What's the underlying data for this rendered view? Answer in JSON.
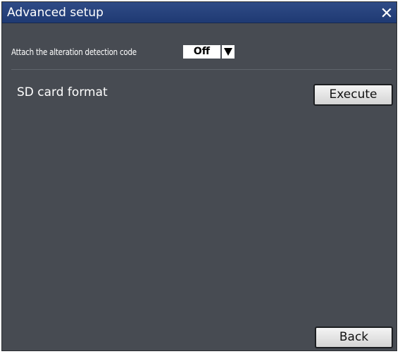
{
  "dialog": {
    "title": "Advanced setup",
    "close_icon": "close-icon"
  },
  "alteration": {
    "label": "Attach the alteration detection code",
    "value": "Off",
    "arrow_icon": "dropdown-arrow-icon"
  },
  "sd_format": {
    "label": "SD card format",
    "execute_label": "Execute"
  },
  "footer": {
    "back_label": "Back"
  },
  "colors": {
    "titlebar": "#1f3a73",
    "panel": "#474b52",
    "button": "#e6e6e6"
  }
}
